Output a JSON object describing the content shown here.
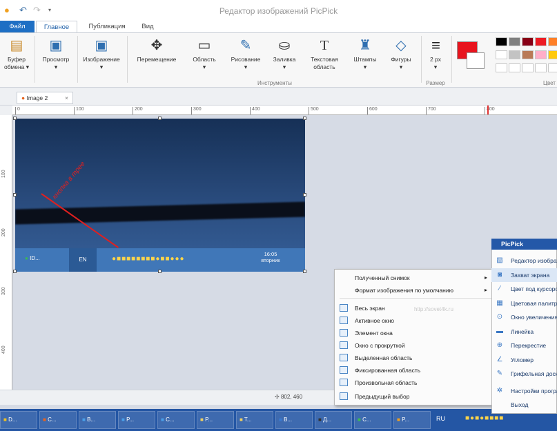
{
  "window": {
    "title": "Редактор изображений PicPick"
  },
  "tabs": [
    "Файл",
    "Главное",
    "Публикация",
    "Вид"
  ],
  "ribbon": {
    "clipboard": [
      "Буфер",
      "обмена"
    ],
    "preview": "Просмотр",
    "image": "Изображение",
    "tools": [
      {
        "label": "Перемещение",
        "icon": "move-icon"
      },
      {
        "label": "Область",
        "icon": "selection-icon"
      },
      {
        "label": "Рисование",
        "icon": "brush-icon"
      },
      {
        "label": "Заливка",
        "icon": "fill-bucket-icon"
      },
      {
        "label": "Текстовая",
        "label2": "область",
        "icon": "text-icon"
      },
      {
        "label": "Штампы",
        "icon": "stamp-icon"
      },
      {
        "label": "Фигуры",
        "icon": "shapes-icon"
      }
    ],
    "tools_group": "Инструменты",
    "size_value": "2 px",
    "size_group": "Размер",
    "colors_group": "Цвет",
    "active_color": "#e8141e",
    "palette": [
      "#000000",
      "#7f7f7f",
      "#880015",
      "#ed1c24",
      "#ff7f27",
      "#ffffff",
      "#c3c3c3",
      "#b97a57",
      "#ffaec9",
      "#ffc90e",
      "#ffffff",
      "#ffffff",
      "#ffffff",
      "#ffffff",
      "#ffffff"
    ]
  },
  "document": {
    "tab": "Image 2",
    "close": "×"
  },
  "ruler": {
    "h": [
      "0",
      "100",
      "200",
      "300",
      "400",
      "500",
      "600",
      "700",
      "800"
    ],
    "v": [
      "100",
      "200",
      "300",
      "400"
    ]
  },
  "canvas": {
    "annotation": "кнопка в трее",
    "tray_time": "16:05",
    "tray_day": "вторник",
    "tray_lang": "EN",
    "tray_app": "ID..."
  },
  "status": {
    "size": "802, 460"
  },
  "context_menu": {
    "items": [
      {
        "label": "Полученный снимок",
        "sub": true,
        "icon": false
      },
      {
        "label": "Формат изображения по умолчанию",
        "sub": true,
        "icon": false
      },
      {
        "label": "Весь экран",
        "icon": true
      },
      {
        "label": "Активное окно",
        "icon": true
      },
      {
        "label": "Элемент окна",
        "icon": true
      },
      {
        "label": "Окно с прокруткой",
        "icon": true
      },
      {
        "label": "Выделенная область",
        "icon": true
      },
      {
        "label": "Фиксированная область",
        "icon": true
      },
      {
        "label": "Произвольная область",
        "icon": true
      },
      {
        "label": "Предыдущий выбор",
        "icon": true
      }
    ],
    "watermark": "http://sovet4k.ru"
  },
  "picpick_menu": {
    "title": "PicPick",
    "items": [
      {
        "label": "Редактор изображений",
        "icon": "editor-icon"
      },
      {
        "label": "Захват экрана",
        "icon": "camera-icon"
      },
      {
        "label": "Цвет под курсором",
        "icon": "eyedropper-icon"
      },
      {
        "label": "Цветовая палитра",
        "icon": "palette-icon"
      },
      {
        "label": "Окно увеличения",
        "icon": "magnifier-icon"
      },
      {
        "label": "Линейка",
        "icon": "ruler-icon"
      },
      {
        "label": "Перекрестие",
        "icon": "crosshair-icon"
      },
      {
        "label": "Угломер",
        "icon": "protractor-icon"
      },
      {
        "label": "Грифельная доска",
        "icon": "pen-icon"
      },
      {
        "label": "Настройки программы",
        "icon": "settings-icon"
      },
      {
        "label": "Выход",
        "icon": "exit-icon"
      }
    ]
  },
  "taskbar": {
    "buttons": [
      "D...",
      "C...",
      "B...",
      "P...",
      "C...",
      "P...",
      "T...",
      "B...",
      "Д...",
      "C...",
      "P..."
    ],
    "lang": "RU"
  }
}
